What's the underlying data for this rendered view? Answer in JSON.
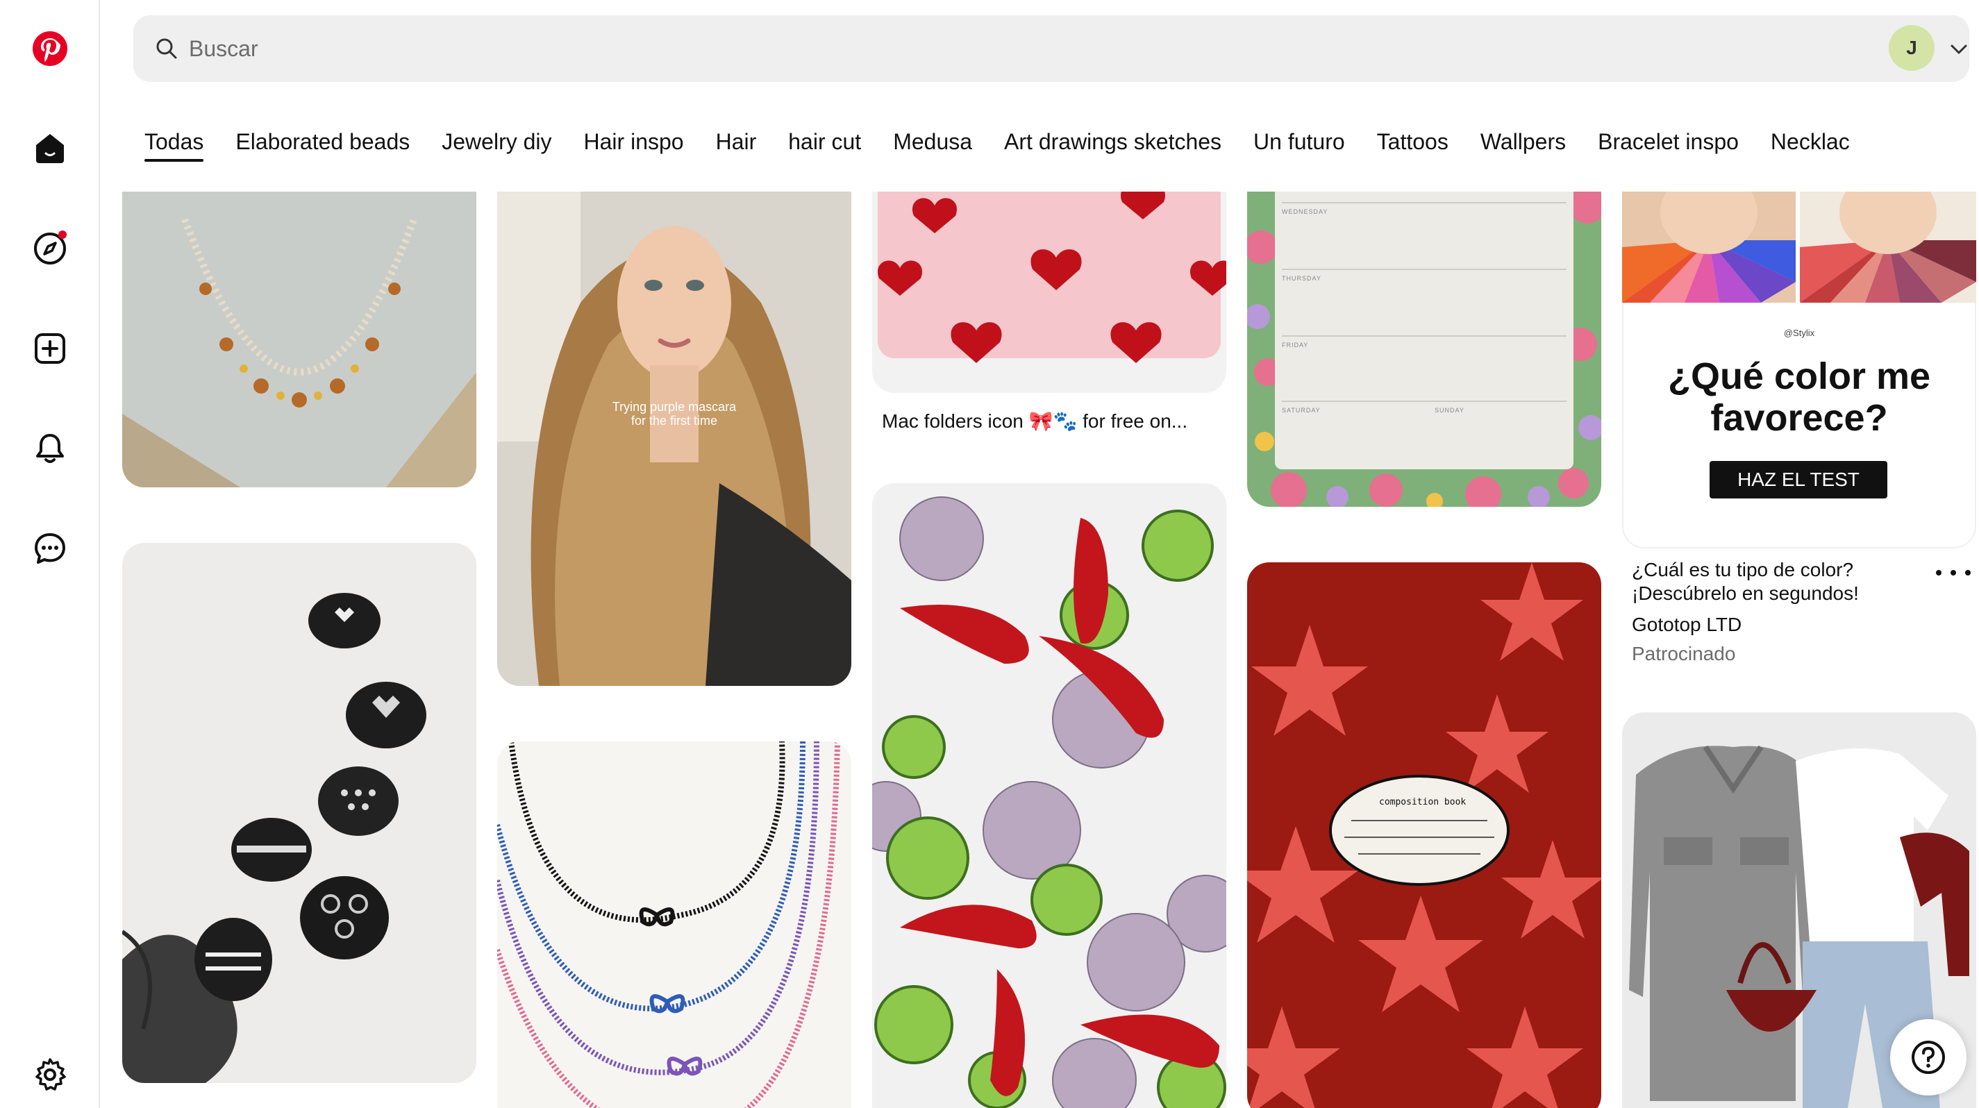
{
  "brand": {
    "color": "#e60023"
  },
  "sidebar": {
    "items": [
      {
        "name": "pinterest-logo",
        "icon": "pinterest-logo-icon"
      },
      {
        "name": "home",
        "icon": "home-icon"
      },
      {
        "name": "explore",
        "icon": "compass-icon"
      },
      {
        "name": "create",
        "icon": "plus-square-icon"
      },
      {
        "name": "notifications",
        "icon": "bell-icon"
      },
      {
        "name": "messages",
        "icon": "chat-bubble-icon"
      },
      {
        "name": "settings",
        "icon": "gear-icon"
      }
    ]
  },
  "search": {
    "placeholder": "Buscar",
    "icon": "search-icon"
  },
  "account": {
    "initial": "J",
    "avatar_color": "#d4e4a6"
  },
  "tabs": [
    "Todas",
    "Elaborated beads",
    "Jewelry diy",
    "Hair inspo",
    "Hair",
    "hair cut",
    "Medusa",
    "Art drawings sketches",
    "Un futuro",
    "Tattoos",
    "Wallpers",
    "Bracelet inspo",
    "Necklac"
  ],
  "active_tab": 0,
  "pins": {
    "hair": {
      "overlay_line1": "Trying purple mascara",
      "overlay_line2": "for the first time"
    },
    "mac_folders": {
      "title": "Mac folders icon 🎀🐾 for free on..."
    },
    "planner": {
      "days": [
        "WEDNESDAY",
        "THURSDAY",
        "FRIDAY",
        "SATURDAY",
        "SUNDAY"
      ]
    },
    "notebook": {
      "label": "composition book"
    },
    "ad": {
      "handle": "@Stylix",
      "headline_line1": "¿Qué color me",
      "headline_line2": "favorece?",
      "cta": "HAZ EL TEST",
      "title_line1": "¿Cuál es tu tipo de color?",
      "title_line2": "¡Descúbrelo en segundos!",
      "advertiser": "Gototop LTD",
      "sponsored": "Patrocinado"
    }
  },
  "help": {
    "icon": "help-icon"
  }
}
